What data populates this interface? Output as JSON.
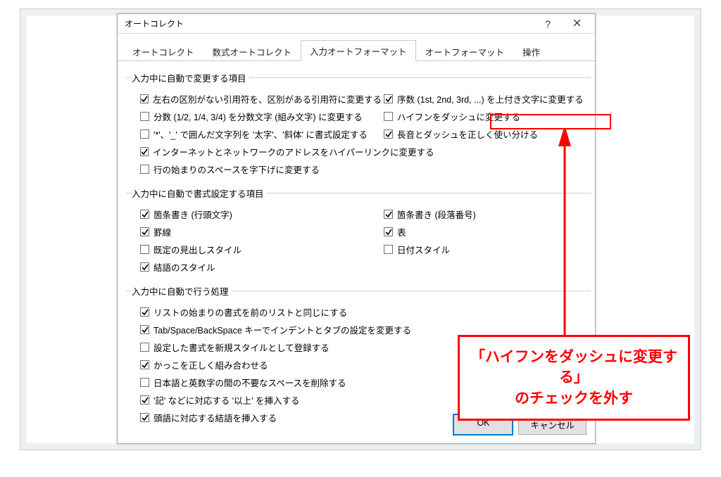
{
  "dialog": {
    "title": "オートコレクト",
    "help_label": "?",
    "close_label": "×"
  },
  "tabs": [
    {
      "label": "オートコレクト",
      "active": false
    },
    {
      "label": "数式オートコレクト",
      "active": false
    },
    {
      "label": "入力オートフォーマット",
      "active": true
    },
    {
      "label": "オートフォーマット",
      "active": false
    },
    {
      "label": "操作",
      "active": false
    }
  ],
  "section1": {
    "title": "入力中に自動で変更する項目",
    "left": [
      {
        "label": "左右の区別がない引用符を、区別がある引用符に変更する",
        "checked": true
      },
      {
        "label": "分数 (1/2, 1/4, 3/4) を分数文字 (組み文字) に変更する",
        "checked": false
      },
      {
        "label": "'*'、'_' で囲んだ文字列を '太字'、'斜体' に書式設定する",
        "checked": false
      },
      {
        "label": "インターネットとネットワークのアドレスをハイパーリンクに変更する",
        "checked": true
      },
      {
        "label": "行の始まりのスペースを字下げに変更する",
        "checked": false
      }
    ],
    "right": [
      {
        "label": "序数 (1st, 2nd, 3rd, ...) を上付き文字に変更する",
        "checked": true
      },
      {
        "label": "ハイフンをダッシュに変更する",
        "checked": false
      },
      {
        "label": "長音とダッシュを正しく使い分ける",
        "checked": true
      }
    ]
  },
  "section2": {
    "title": "入力中に自動で書式設定する項目",
    "left": [
      {
        "label": "箇条書き (行頭文字)",
        "checked": true
      },
      {
        "label": "罫線",
        "checked": true
      },
      {
        "label": "既定の見出しスタイル",
        "checked": false
      },
      {
        "label": "結語のスタイル",
        "checked": true
      }
    ],
    "right": [
      {
        "label": "箇条書き (段落番号)",
        "checked": true
      },
      {
        "label": "表",
        "checked": true
      },
      {
        "label": "日付スタイル",
        "checked": false
      }
    ]
  },
  "section3": {
    "title": "入力中に自動で行う処理",
    "items": [
      {
        "label": "リストの始まりの書式を前のリストと同じにする",
        "checked": true
      },
      {
        "label": "Tab/Space/BackSpace キーでインデントとタブの設定を変更する",
        "checked": true
      },
      {
        "label": "設定した書式を新規スタイルとして登録する",
        "checked": false
      },
      {
        "label": "かっこを正しく組み合わせる",
        "checked": true
      },
      {
        "label": "日本語と英数字の間の不要なスペースを削除する",
        "checked": false
      },
      {
        "label": "'記' などに対応する '以上' を挿入する",
        "checked": true
      },
      {
        "label": "頭語に対応する結語を挿入する",
        "checked": true
      }
    ]
  },
  "buttons": {
    "ok": "OK",
    "cancel": "キャンセル"
  },
  "annotation": {
    "line1": "「ハイフンをダッシュに変更する」",
    "line2": "のチェックを外す"
  }
}
